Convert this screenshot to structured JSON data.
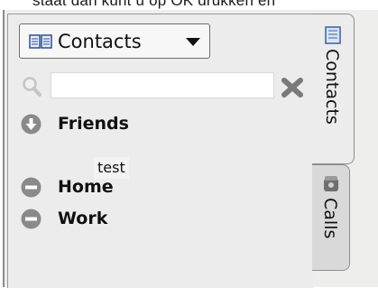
{
  "top_text": "staat dan kunt u op OK drukken en",
  "address_book": {
    "selected": "Contacts",
    "icon": "address-book-icon"
  },
  "search": {
    "value": "",
    "placeholder": "",
    "icon": "magnifier-icon",
    "clear_icon": "clear-x-icon"
  },
  "groups": [
    {
      "label": "Friends",
      "state": "expanded",
      "icon": "expand-arrow-icon",
      "contacts": [
        "test"
      ]
    },
    {
      "label": "Home",
      "state": "collapsed",
      "icon": "minus-icon",
      "contacts": []
    },
    {
      "label": "Work",
      "state": "collapsed",
      "icon": "minus-icon",
      "contacts": []
    }
  ],
  "tabs": [
    {
      "label": "Contacts",
      "icon": "address-book-icon",
      "active": true
    },
    {
      "label": "Calls",
      "icon": "phone-icon",
      "active": false
    }
  ],
  "colors": {
    "icon_grey": "#8a8a8a",
    "clear_grey": "#7a7a7a"
  }
}
